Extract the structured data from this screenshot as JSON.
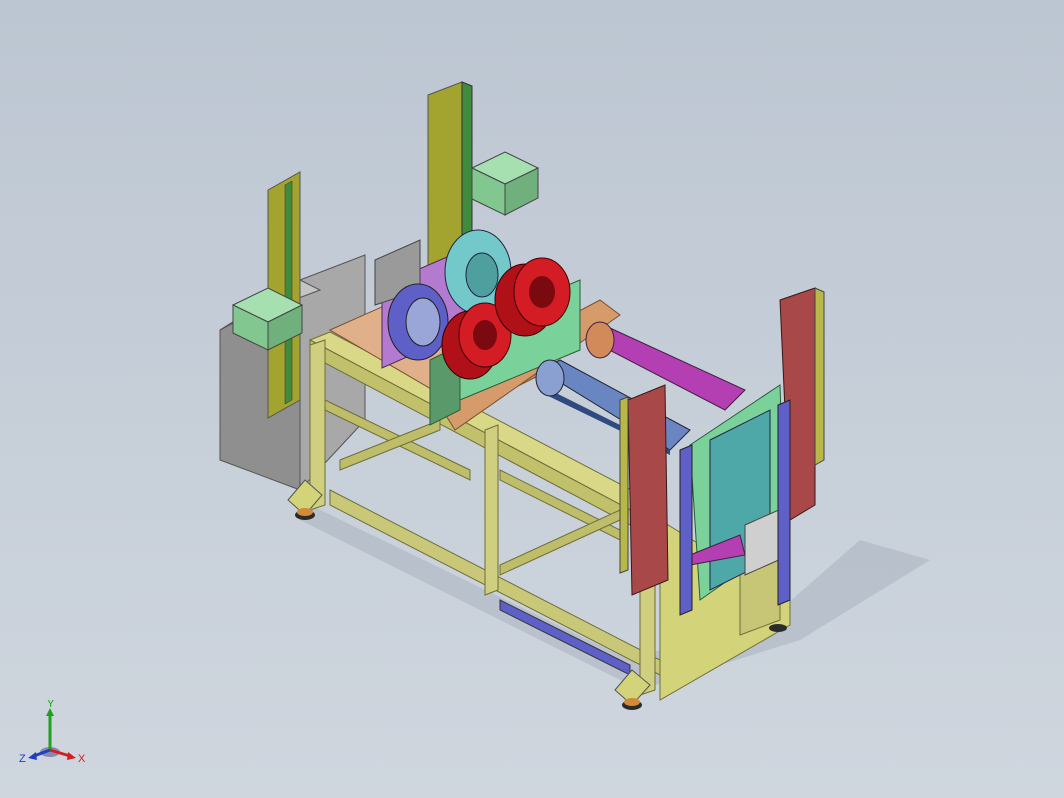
{
  "viewport": {
    "background_top": "#bcc6d2",
    "background_bottom": "#cfd6de"
  },
  "colors": {
    "frame_yellow": "#d3d37a",
    "frame_edge": "#6e6e3a",
    "post_olive": "#9a9a2e",
    "post_stripe": "#3f8c3f",
    "box_green": "#8fcf9a",
    "cabinet_grey": "#9a9a9a",
    "spindle_red": "#d41c24",
    "plate_blue": "#5f5fc8",
    "plate_purple": "#b47ad0",
    "ring_teal": "#73c9c9",
    "saddle_green": "#7bd19a",
    "rail_copper": "#d59b6a",
    "roller_magenta": "#b33fb3",
    "roller_steel": "#4a6aa8",
    "guard_maroon": "#a84848",
    "end_teal": "#4ea8a8",
    "foot_black": "#2b2b2b"
  },
  "triad": {
    "x_label": "X",
    "y_label": "Y",
    "z_label": "Z",
    "x_color": "#d02020",
    "y_color": "#20a020",
    "z_color": "#2040c0"
  }
}
